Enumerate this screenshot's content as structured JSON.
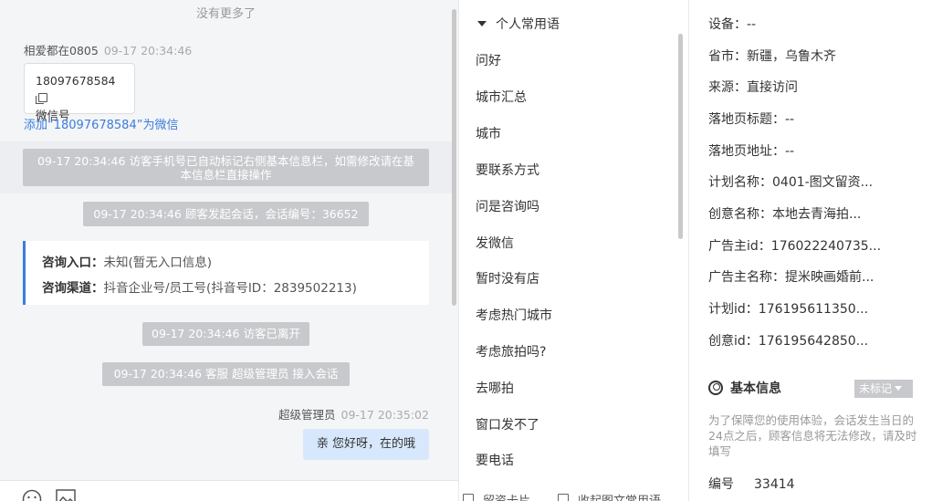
{
  "chat": {
    "no_more": "没有更多了",
    "msg1": {
      "sender": "相爱都在0805",
      "time": "09-17 20:34:46"
    },
    "phone_card": {
      "number": "18097678584",
      "label": "微信号"
    },
    "add_link": "添加“18097678584”为微信",
    "system_msgs": [
      "09-17 20:34:46 访客手机号已自动标记右侧基本信息栏，如需修改请在基本信息栏直接操作",
      "09-17 20:34:46 顾客发起会话，会话编号：36652",
      "09-17 20:34:46 访客已离开",
      "09-17 20:34:46 客服 超级管理员 接入会话"
    ],
    "consult": {
      "entry_label": "咨询入口：",
      "entry_value": "未知(暂无入口信息)",
      "channel_label": "咨询渠道：",
      "channel_value": "抖音企业号/员工号(抖音号ID：2839502213)"
    },
    "msg2": {
      "sender": "超级管理员",
      "time": "09-17 20:35:02",
      "text": "亲 您好呀，在的哦"
    }
  },
  "phrases": {
    "group_title": "个人常用语",
    "items": [
      "问好",
      "城市汇总",
      "城市",
      "要联系方式",
      "问是咨询吗",
      "发微信",
      "暂时没有店",
      "考虑热门城市",
      "考虑旅拍吗?",
      "去哪拍",
      "窗口发不了",
      "要电话"
    ],
    "footer": {
      "left": "留资卡片",
      "right": "收起图文常用语"
    }
  },
  "visitor": {
    "fields": [
      {
        "label": "设备：",
        "value": "--"
      },
      {
        "label": "省市：",
        "value": "新疆，乌鲁木齐"
      },
      {
        "label": "来源：",
        "value": "直接访问"
      },
      {
        "label": "落地页标题：",
        "value": "--"
      },
      {
        "label": "落地页地址：",
        "value": "--"
      },
      {
        "label": "计划名称：",
        "value": "0401-图文留资..."
      },
      {
        "label": "创意名称：",
        "value": "本地去青海拍..."
      },
      {
        "label": "广告主id：",
        "value": "176022240735..."
      },
      {
        "label": "广告主名称：",
        "value": "提米映画婚前..."
      },
      {
        "label": "计划id：",
        "value": "176195611350..."
      },
      {
        "label": "创意id：",
        "value": "176195642850..."
      }
    ],
    "basic_title": "基本信息",
    "tag_label": "未标记",
    "note": "为了保障您的使用体验，会话发生当日的24点之后，顾客信息将无法修改，请及时填写",
    "number": {
      "label": "编号",
      "value": "33414"
    }
  }
}
